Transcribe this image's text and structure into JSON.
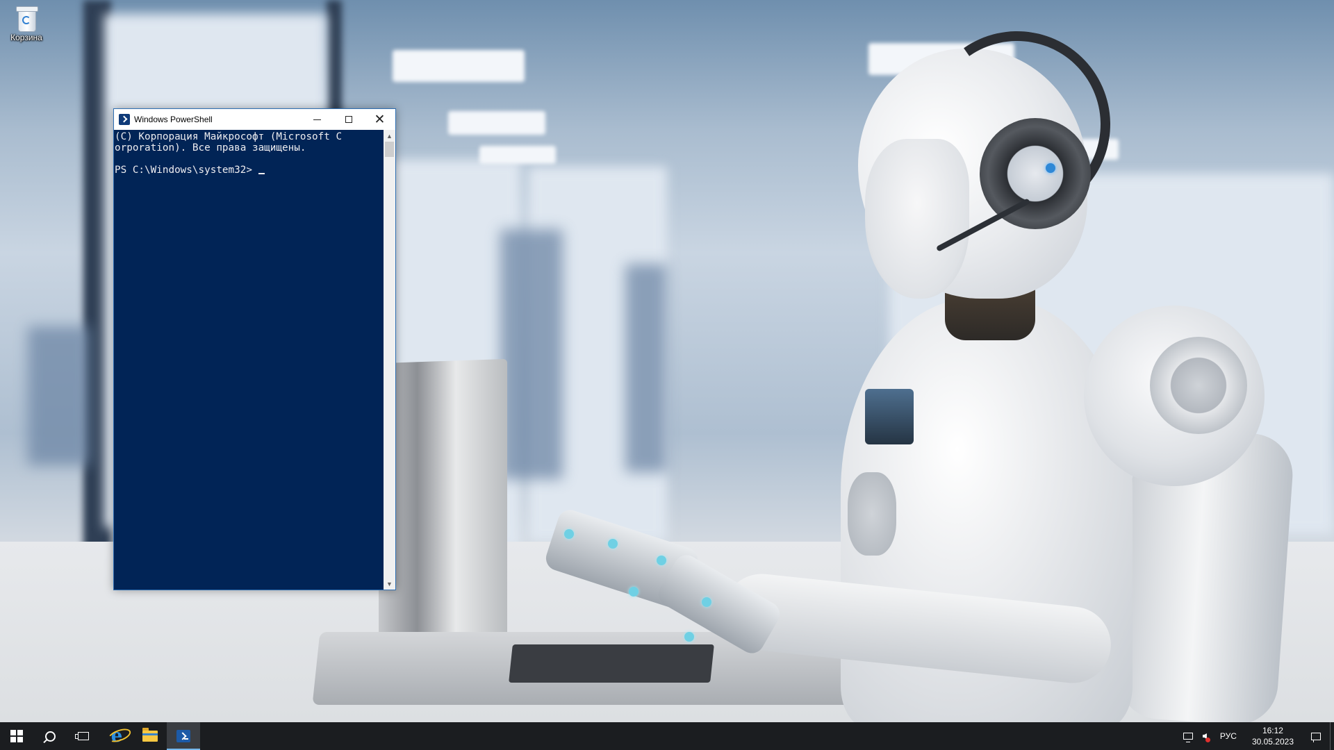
{
  "desktop": {
    "icons": [
      {
        "label": "Корзина",
        "icon": "recycle-bin-icon"
      }
    ]
  },
  "powershell": {
    "title": "Windows PowerShell",
    "icon": "powershell-icon",
    "console_background": "#012456",
    "console_lines": [
      "(C) Корпорация Майкрософт (Microsoft C",
      "orporation). Все права защищены.",
      "",
      "PS C:\\Windows\\system32> "
    ],
    "buttons": {
      "minimize": "minimize-icon",
      "maximize": "maximize-icon",
      "close": "close-icon"
    }
  },
  "taskbar": {
    "items": [
      {
        "name": "start",
        "icon": "windows-logo-icon"
      },
      {
        "name": "search",
        "icon": "search-icon"
      },
      {
        "name": "task-view",
        "icon": "task-view-icon"
      },
      {
        "name": "internet-explorer",
        "icon": "internet-explorer-icon"
      },
      {
        "name": "file-explorer",
        "icon": "folder-icon"
      },
      {
        "name": "powershell",
        "icon": "powershell-icon",
        "active": true
      }
    ],
    "tray": {
      "network_icon": "network-icon",
      "volume_icon": "volume-muted-icon",
      "language": "РУС",
      "time": "16:12",
      "date": "30.05.2023",
      "notifications_icon": "action-center-icon"
    },
    "accent": "#76b9ed"
  }
}
